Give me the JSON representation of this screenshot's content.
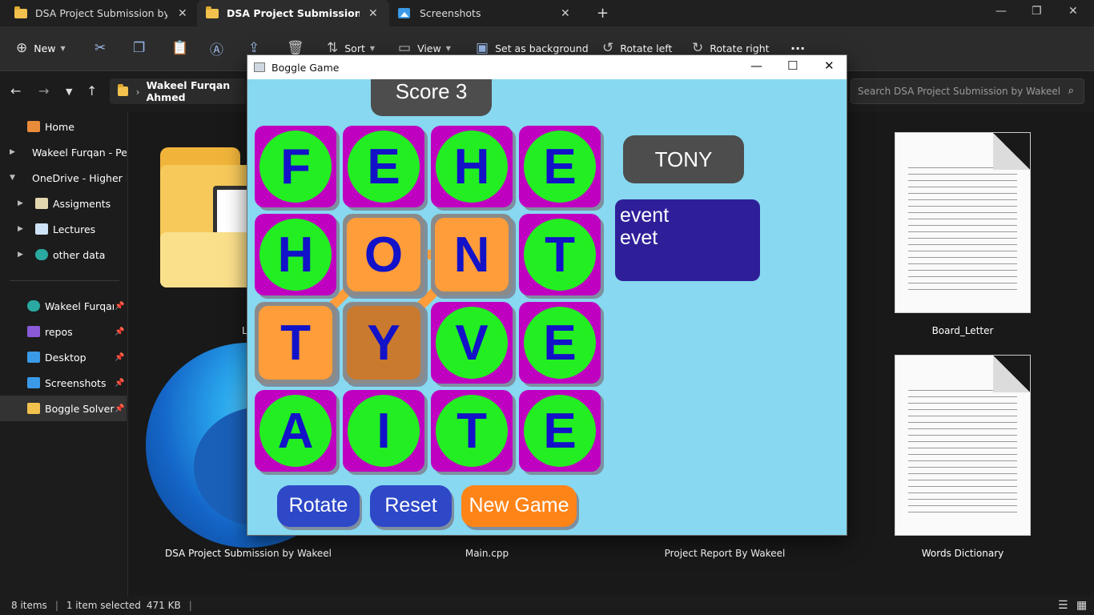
{
  "explorer": {
    "tabs": [
      {
        "label": "DSA Project Submission by Wa"
      },
      {
        "label": "DSA Project Submission by W"
      },
      {
        "label": "Screenshots"
      }
    ],
    "toolbar": {
      "new": "New",
      "sort": "Sort",
      "view": "View",
      "set_background": "Set as background",
      "rotate_left": "Rotate left",
      "rotate_right": "Rotate right",
      "more": "···"
    },
    "breadcrumb": "Wakeel Furqan Ahmed",
    "search_placeholder": "Search DSA Project Submission by Wakeel",
    "sidebar": {
      "items": [
        {
          "label": "Home"
        },
        {
          "label": "Wakeel Furqan - Pe"
        },
        {
          "label": "OneDrive - Higher E"
        },
        {
          "label": "Assigments"
        },
        {
          "label": "Lectures"
        },
        {
          "label": "other data"
        },
        {
          "label": "Wakeel Furqan A"
        },
        {
          "label": "repos"
        },
        {
          "label": "Desktop"
        },
        {
          "label": "Screenshots"
        },
        {
          "label": "Boggle Solver SD"
        }
      ]
    },
    "files": [
      {
        "label": "L"
      },
      {
        "label": "Board_Letter"
      },
      {
        "label": "DSA Project Submission by Wakeel"
      },
      {
        "label": "Main.cpp"
      },
      {
        "label": "Project Report By Wakeel"
      },
      {
        "label": "Words Dictionary"
      }
    ],
    "status": {
      "items": "8 items",
      "selected": "1 item selected",
      "size": "471 KB"
    }
  },
  "game": {
    "window_title": "Boggle Game",
    "score": "Score 3",
    "player": "TONY",
    "words": [
      "event",
      "evet"
    ],
    "board": [
      [
        "F",
        "E",
        "H",
        "E"
      ],
      [
        "H",
        "O",
        "N",
        "T"
      ],
      [
        "T",
        "Y",
        "V",
        "E"
      ],
      [
        "A",
        "I",
        "T",
        "E"
      ]
    ],
    "selected_path": [
      [
        2,
        0
      ],
      [
        1,
        1
      ],
      [
        1,
        2
      ],
      [
        2,
        1
      ]
    ],
    "buttons": {
      "rotate": "Rotate",
      "reset": "Reset",
      "new_game": "New Game"
    },
    "colors": {
      "background": "#87d8f0",
      "cell": "#c000c0",
      "face": "#22ee22",
      "letter": "#1212c8",
      "selected": "#ff9d3a",
      "current": "#c97a2f",
      "path": "#ff9d3a"
    }
  }
}
